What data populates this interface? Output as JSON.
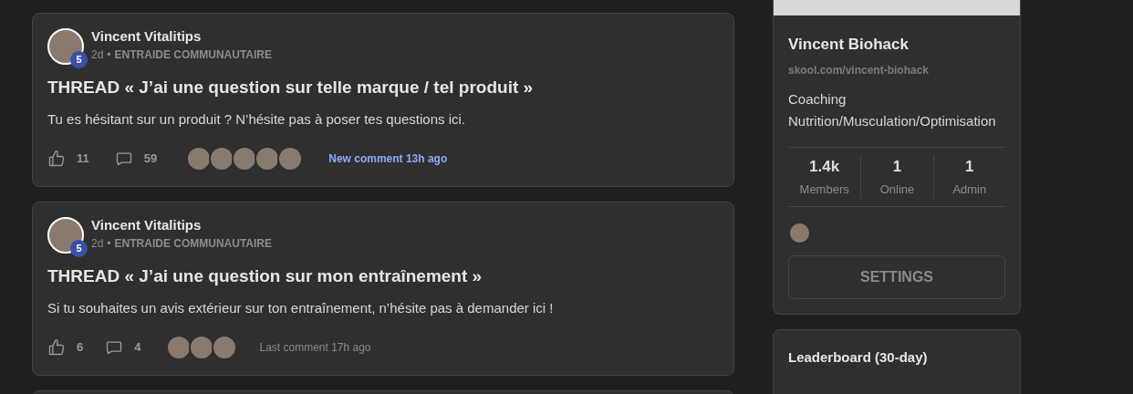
{
  "posts": [
    {
      "author": "Vincent Vitalitips",
      "level_badge": "5",
      "age": "2d",
      "separator": "•",
      "category": "ENTRAIDE COMMUNAUTAIRE",
      "title": "THREAD « J’ai une question sur telle marque / tel produit »",
      "body": "Tu es hésitant sur un produit ? N’hésite pas à poser tes questions ici.",
      "likes": "11",
      "comments": "59",
      "commenters": [
        {
          "kind": "photo"
        },
        {
          "kind": "photo"
        },
        {
          "kind": "photo"
        },
        {
          "kind": "photo"
        },
        {
          "kind": "photo"
        }
      ],
      "activity": {
        "text": "New comment 13h ago",
        "new": true
      }
    },
    {
      "author": "Vincent Vitalitips",
      "level_badge": "5",
      "age": "2d",
      "separator": "•",
      "category": "ENTRAIDE COMMUNAUTAIRE",
      "title": "THREAD « J’ai une question sur mon entraînement »",
      "body": "Si tu souhaites un avis extérieur sur ton entraînement, n’hésite pas à demander ici !",
      "likes": "6",
      "comments": "4",
      "commenters": [
        {
          "kind": "photo"
        },
        {
          "kind": "photo"
        },
        {
          "kind": "photo"
        }
      ],
      "activity": {
        "text": "Last comment 17h ago",
        "new": false
      }
    }
  ],
  "group": {
    "name": "Vincent Biohack",
    "url": "skool.com/vincent-biohack",
    "description": "Coaching Nutrition/Musculation/Optimisation",
    "stats": [
      {
        "value": "1.4k",
        "label": "Members"
      },
      {
        "value": "1",
        "label": "Online"
      },
      {
        "value": "1",
        "label": "Admin"
      }
    ],
    "admins": [
      {
        "kind": "photo"
      }
    ],
    "button": "SETTINGS"
  },
  "leaderboard": {
    "title": "Leaderboard (30-day)"
  }
}
